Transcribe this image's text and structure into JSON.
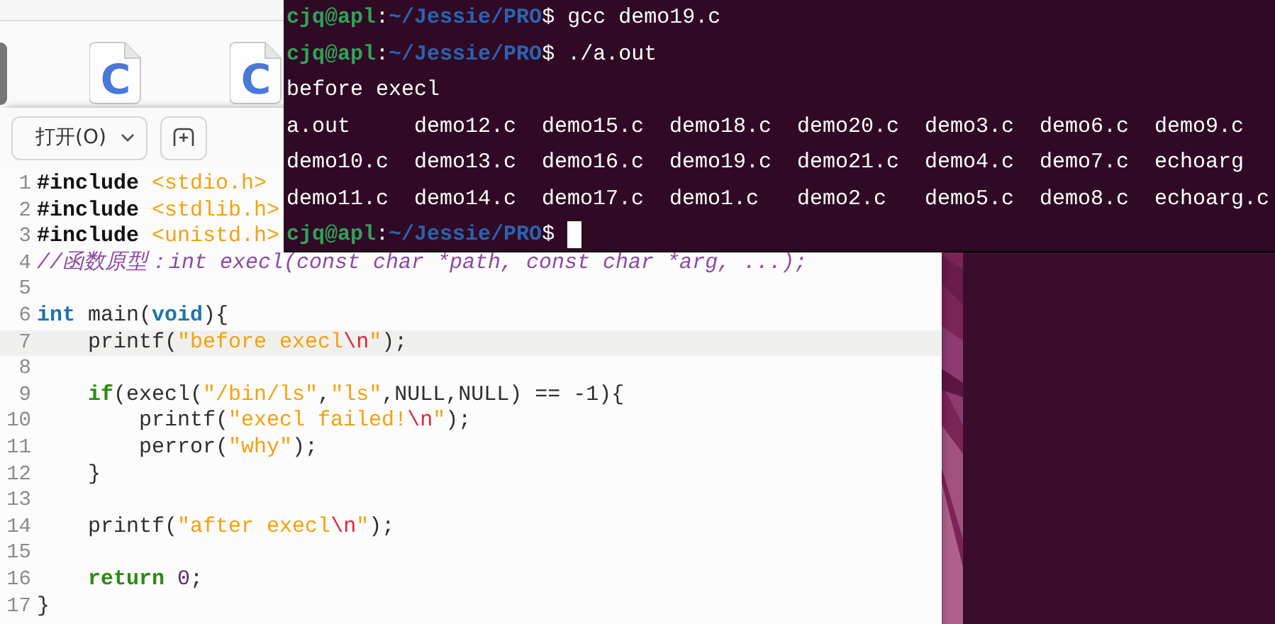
{
  "file_manager": {
    "files": [
      {
        "glyph": "C"
      },
      {
        "glyph": "C"
      }
    ]
  },
  "editor": {
    "open_button": "打开(O)",
    "lines": [
      {
        "number": "1",
        "current": false,
        "tokens": [
          {
            "kind": "preproc",
            "text": "#include "
          },
          {
            "kind": "header",
            "text": "<stdio.h>"
          }
        ]
      },
      {
        "number": "2",
        "current": false,
        "tokens": [
          {
            "kind": "preproc",
            "text": "#include "
          },
          {
            "kind": "header",
            "text": "<stdlib.h>"
          }
        ]
      },
      {
        "number": "3",
        "current": false,
        "tokens": [
          {
            "kind": "preproc",
            "text": "#include "
          },
          {
            "kind": "header",
            "text": "<unistd.h>"
          }
        ]
      },
      {
        "number": "4",
        "current": false,
        "tokens": [
          {
            "kind": "comment",
            "text": "//函数原型：int execl(const char *path, const char *arg, ...);"
          }
        ]
      },
      {
        "number": "5",
        "current": false
      },
      {
        "number": "6",
        "current": false,
        "tokens": [
          {
            "kind": "type",
            "text": "int"
          },
          {
            "kind": "plain",
            "text": " main("
          },
          {
            "kind": "type",
            "text": "void"
          },
          {
            "kind": "plain",
            "text": "){"
          }
        ]
      },
      {
        "number": "7",
        "current": true,
        "tokens": [
          {
            "kind": "plain",
            "text": "    printf("
          },
          {
            "kind": "string",
            "text": "\"before execl"
          },
          {
            "kind": "escape",
            "text": "\\n"
          },
          {
            "kind": "string",
            "text": "\""
          },
          {
            "kind": "plain",
            "text": ");"
          }
        ]
      },
      {
        "number": "8",
        "current": false
      },
      {
        "number": "9",
        "current": false,
        "tokens": [
          {
            "kind": "keyword",
            "text": "    if"
          },
          {
            "kind": "plain",
            "text": "(execl("
          },
          {
            "kind": "string",
            "text": "\"/bin/ls\""
          },
          {
            "kind": "plain",
            "text": ","
          },
          {
            "kind": "string",
            "text": "\"ls\""
          },
          {
            "kind": "plain",
            "text": ",NULL,NULL) == -1){"
          }
        ]
      },
      {
        "number": "10",
        "current": false,
        "tokens": [
          {
            "kind": "plain",
            "text": "        printf("
          },
          {
            "kind": "string",
            "text": "\"execl failed!"
          },
          {
            "kind": "escape",
            "text": "\\n"
          },
          {
            "kind": "string",
            "text": "\""
          },
          {
            "kind": "plain",
            "text": ");"
          }
        ]
      },
      {
        "number": "11",
        "current": false,
        "tokens": [
          {
            "kind": "plain",
            "text": "        perror("
          },
          {
            "kind": "string",
            "text": "\"why\""
          },
          {
            "kind": "plain",
            "text": ");"
          }
        ]
      },
      {
        "number": "12",
        "current": false,
        "tokens": [
          {
            "kind": "plain",
            "text": "    }"
          }
        ]
      },
      {
        "number": "13",
        "current": false
      },
      {
        "number": "14",
        "current": false,
        "tokens": [
          {
            "kind": "plain",
            "text": "    printf("
          },
          {
            "kind": "string",
            "text": "\"after execl"
          },
          {
            "kind": "escape",
            "text": "\\n"
          },
          {
            "kind": "string",
            "text": "\""
          },
          {
            "kind": "plain",
            "text": ");"
          }
        ]
      },
      {
        "number": "15",
        "current": false
      },
      {
        "number": "16",
        "current": false,
        "tokens": [
          {
            "kind": "keyword",
            "text": "    return"
          },
          {
            "kind": "number",
            "text": " 0"
          },
          {
            "kind": "plain",
            "text": ";"
          }
        ]
      },
      {
        "number": "17",
        "current": false,
        "tokens": [
          {
            "kind": "plain",
            "text": "}"
          }
        ]
      }
    ]
  },
  "terminal": {
    "lines": [
      {
        "kind": "prompt",
        "user": "cjq@apl",
        "separator": ":",
        "path": "~/Jessie/PRO",
        "symbol": "$",
        "command": "gcc demo19.c",
        "cursor": false
      },
      {
        "kind": "prompt",
        "user": "cjq@apl",
        "separator": ":",
        "path": "~/Jessie/PRO",
        "symbol": "$",
        "command": "./a.out",
        "cursor": false
      },
      {
        "kind": "output",
        "text": "before execl"
      },
      {
        "kind": "listing",
        "files": [
          "a.out",
          "demo12.c",
          "demo15.c",
          "demo18.c",
          "demo20.c",
          "demo3.c",
          "demo6.c",
          "demo9.c"
        ]
      },
      {
        "kind": "listing",
        "files": [
          "demo10.c",
          "demo13.c",
          "demo16.c",
          "demo19.c",
          "demo21.c",
          "demo4.c",
          "demo7.c",
          "echoarg"
        ]
      },
      {
        "kind": "listing",
        "files": [
          "demo11.c",
          "demo14.c",
          "demo17.c",
          "demo1.c",
          "demo2.c",
          "demo5.c",
          "demo8.c",
          "echoarg.c"
        ]
      },
      {
        "kind": "prompt",
        "user": "cjq@apl",
        "separator": ":",
        "path": "~/Jessie/PRO",
        "symbol": "$",
        "cursor": true
      }
    ]
  }
}
